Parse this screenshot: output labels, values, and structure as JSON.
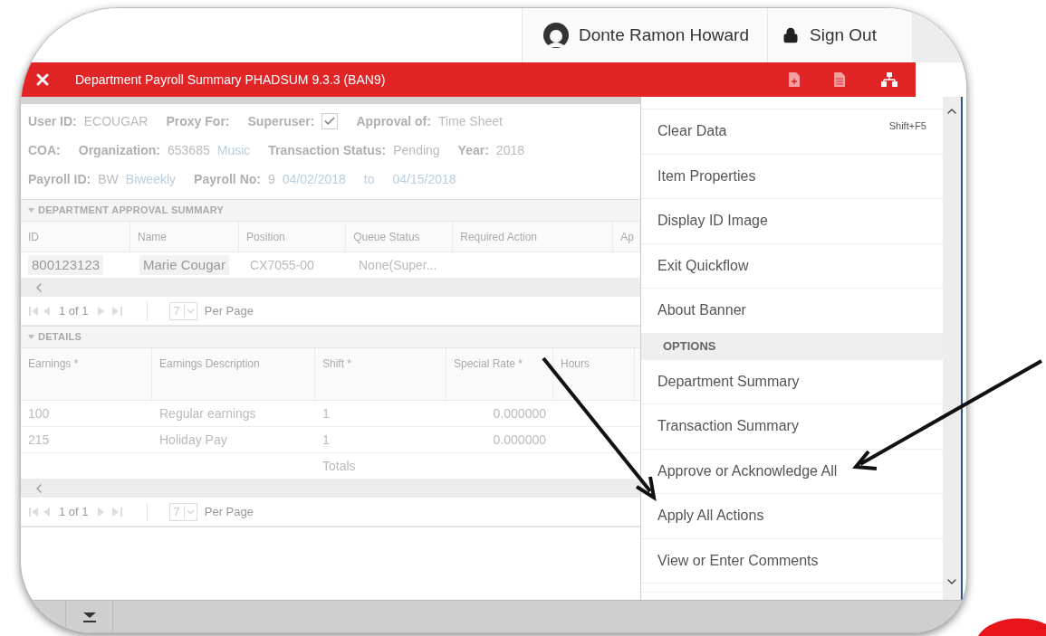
{
  "header": {
    "user": "Donte Ramon Howard",
    "sign_out": "Sign Out"
  },
  "title_bar": {
    "title": "Department Payroll Summary PHADSUM 9.3.3 (BAN9)"
  },
  "info": {
    "rows": [
      [
        {
          "label": "User ID:",
          "value": "ECOUGAR"
        },
        {
          "label": "Proxy For:"
        },
        {
          "label": "Superuser:",
          "kind": "checkbox",
          "checked": true
        },
        {
          "label": "Approval of:",
          "value": "Time Sheet"
        }
      ],
      [
        {
          "label": "COA:"
        },
        {
          "label": "Organization:",
          "value": "653685",
          "link": "Music"
        },
        {
          "label": "Transaction Status:",
          "value": "Pending"
        },
        {
          "label": "Year:",
          "value": "2018"
        }
      ],
      [
        {
          "label": "Payroll ID:",
          "value": "BW",
          "link": "Biweekly"
        },
        {
          "label": "Payroll No:",
          "value": "9",
          "link": "04/02/2018"
        },
        {
          "link": "to"
        },
        {
          "link": "04/15/2018"
        }
      ]
    ]
  },
  "sections": [
    {
      "title": "DEPARTMENT APPROVAL SUMMARY",
      "columns": [
        "ID",
        "Name",
        "Position",
        "Queue Status",
        "Required Action",
        "Ap"
      ],
      "rows": [
        [
          "800123123",
          "Marie Cougar",
          "CX7055-00",
          "None(Super...",
          ""
        ]
      ],
      "pager": {
        "page": "1 of 1",
        "per_page": "7",
        "per_page_label": "Per Page"
      }
    },
    {
      "title": "DETAILS",
      "columns": [
        "Earnings *",
        "Earnings Description",
        "Shift *",
        "Special Rate *",
        "Hours"
      ],
      "rows": [
        [
          "100",
          "Regular earnings",
          "1",
          "0.000000",
          ""
        ],
        [
          "215",
          "Holiday Pay",
          "1",
          "0.000000",
          ""
        ],
        [
          "",
          "",
          "Totals",
          "",
          ""
        ]
      ],
      "pager": {
        "page": "1 of 1",
        "per_page": "7",
        "per_page_label": "Per Page"
      }
    }
  ],
  "menu": [
    {
      "kind": "item",
      "label": "Clear Data",
      "shortcut": "Shift+F5"
    },
    {
      "kind": "item",
      "label": "Item Properties"
    },
    {
      "kind": "item",
      "label": "Display ID Image"
    },
    {
      "kind": "item",
      "label": "Exit Quickflow"
    },
    {
      "kind": "item",
      "label": "About Banner"
    },
    {
      "kind": "header",
      "label": "OPTIONS"
    },
    {
      "kind": "item",
      "label": "Department Summary"
    },
    {
      "kind": "item",
      "label": "Transaction Summary"
    },
    {
      "kind": "item",
      "label": "Approve or Acknowledge All"
    },
    {
      "kind": "item",
      "label": "Apply All Actions"
    },
    {
      "kind": "item",
      "label": "View or Enter Comments"
    }
  ]
}
